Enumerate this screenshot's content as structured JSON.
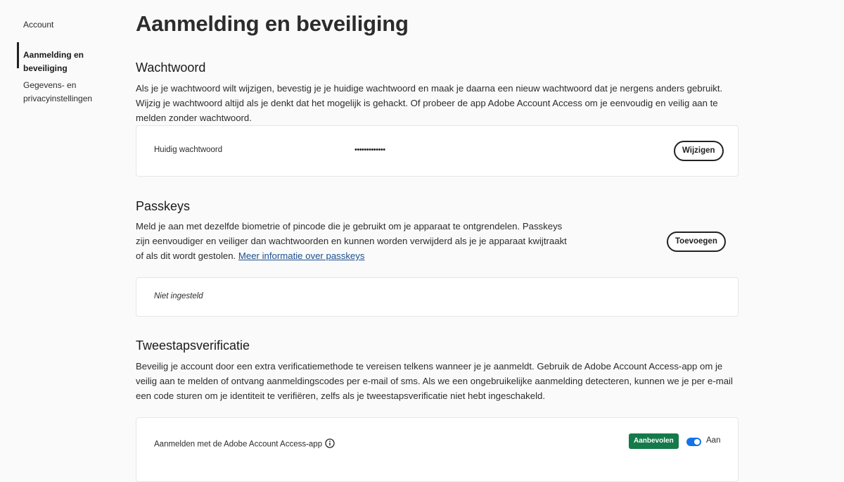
{
  "sidebar": {
    "items": [
      {
        "label": "Account"
      },
      {
        "label": "Aanmelding en beveiliging"
      },
      {
        "label": "Gegevens- en privacyinstellingen"
      }
    ]
  },
  "page": {
    "title": "Aanmelding en beveiliging"
  },
  "password": {
    "title": "Wachtwoord",
    "description": "Als je je wachtwoord wilt wijzigen, bevestig je je huidige wachtwoord en maak je daarna een nieuw wachtwoord dat je nergens anders gebruikt. Wijzig je wachtwoord altijd als je denkt dat het mogelijk is gehackt. Of probeer de app Adobe Account Access om je eenvoudig en veilig aan te melden zonder wachtwoord.",
    "current_label": "Huidig wachtwoord",
    "masked_value": "•••••••••••••",
    "change_button": "Wijzigen"
  },
  "passkeys": {
    "title": "Passkeys",
    "description": "Meld je aan met dezelfde biometrie of pincode die je gebruikt om je apparaat te ontgrendelen. Passkeys zijn eenvoudiger en veiliger dan wachtwoorden en kunnen worden verwijderd als je je apparaat kwijtraakt of als dit wordt gestolen.",
    "link_text": "Meer informatie over passkeys",
    "add_button": "Toevoegen",
    "status": "Niet ingesteld"
  },
  "two_step": {
    "title": "Tweestapsverificatie",
    "description": "Beveilig je account door een extra verificatiemethode te vereisen telkens wanneer je je aanmeldt. Gebruik de Adobe Account Access-app om je veilig aan te melden of ontvang aanmeldingscodes per e-mail of sms. Als we een ongebruikelijke aanmelding detecteren, kunnen we je per e-mail een code sturen om je identiteit te verifiëren, zelfs als je tweestapsverificatie niet hebt ingeschakeld.",
    "app_option_label": "Aanmelden met de Adobe Account Access-app",
    "recommended_badge": "Aanbevolen",
    "toggle_label": "Aan",
    "toggle_on": true
  },
  "colors": {
    "accent": "#1473e6",
    "badge": "#147a4a",
    "link": "#1b4f8f"
  }
}
